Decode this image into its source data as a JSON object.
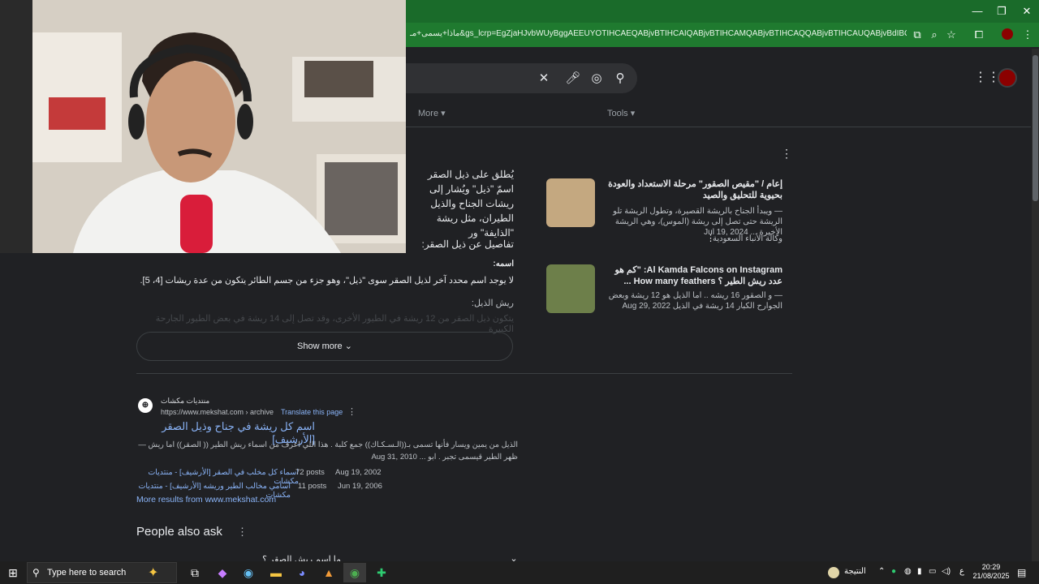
{
  "browser": {
    "url": "ماذا+يسمى+مـ&gs_lcrp=EgZjaHJvbWUyBggAEEUYOTIHCAEQABjvBTIHCAIQABjvBTIHCAMQABjvBTIHCAQQABjvBTIHCAUQABjvBdIBCDYyODVqMGo3q...",
    "window_controls": [
      "—",
      "❐",
      "✕"
    ]
  },
  "search": {
    "clear_icon": "close-icon",
    "tabs": {
      "more": "More",
      "tools": "Tools"
    }
  },
  "snippet": {
    "body": "يُطلق على ذيل الصقر اسمّ \"ذيل\" ويُشار إلى ريشات الجناح والذيل الطيران، مثل ريشة \"الذايفة\" ور",
    "details_title": "تفاصيل عن ذيل الصقر:",
    "name_heading": "اسمه:",
    "name_text": "لا يوجد اسم محدد آخر لذيل الصقر سوى \"ذيل\"، وهو جزء من جسم الطائر يتكون من عدة ريشات [4، 5].",
    "feathers_heading": "ريش الذيل:",
    "faded_text": "يتكون ذيل الصقر من 12 ريشة في الطيور الأخرى، وقد تصل إلى 14 ريشة في بعض الطيور الجارحة الكبيرة",
    "show_more": "Show more"
  },
  "cards": [
    {
      "title": "إعام / \"مقيص الصقور\" مرحلة الاستعداد والعودة بحيوية للتحليق والصيد",
      "date": "Jul 19, 2024",
      "desc": "— ويبدأ الجناح بالريشة القصيرة، وتطول الريشة تلو الريشة حتى تصل إلى ريشة (الموس)، وهي الريشة الأخيرة ...",
      "source": "وكالة الأنباء السعودية"
    },
    {
      "title": "Al Kamda Falcons on Instagram: \"كم هو عدد ريش الطير ؟ How many feathers ...",
      "date": "Aug 29, 2022",
      "desc": "— و الصقور 16 ريشه .. اما الذيل هو 12 ريشة وبعض الجوارح الكبار 14 ريشة في الذيل"
    }
  ],
  "result2": {
    "site": "منتديات مكشات",
    "url": "https://www.mekshat.com › archive",
    "translate": "Translate this page",
    "title": "اسم كل ريشة في جناح وذيل الصقر [الأرشيف]",
    "date": "Aug 31, 2010",
    "snippet": "الذيل من يمين ويسار فأنها تسمى بـ((الـسـكـاك)) جمع كلبة . هذا اللي اعرف من اسماء ريش الطير (( الصقر)) اما ريش — ظهر الطير قيسمى تجبر . ابو ...",
    "sublinks": [
      {
        "text": "اسماء كل مخلب في الصقر [الأرشيف] - منتديات مكشات",
        "posts": "72 posts",
        "date": "Aug 19, 2002"
      },
      {
        "text": "اسامي مخالب الطير وريشه [الأرشيف] - منتديات مكشات",
        "posts": "11 posts",
        "date": "Jun 19, 2006"
      }
    ],
    "more_results": "More results from www.mekshat.com"
  },
  "people_also_ask": {
    "title": "People also ask",
    "question": "ما اسم ريش الصقر ؟"
  },
  "taskbar": {
    "search_placeholder": "Type here to search",
    "weather_label": "النتيجة",
    "lang": "ع",
    "time": "20:29",
    "date": "21/08/2025"
  },
  "colors": {
    "accent_green": "#1f7a2f",
    "link_blue": "#8ab4f8",
    "background": "#202124"
  }
}
